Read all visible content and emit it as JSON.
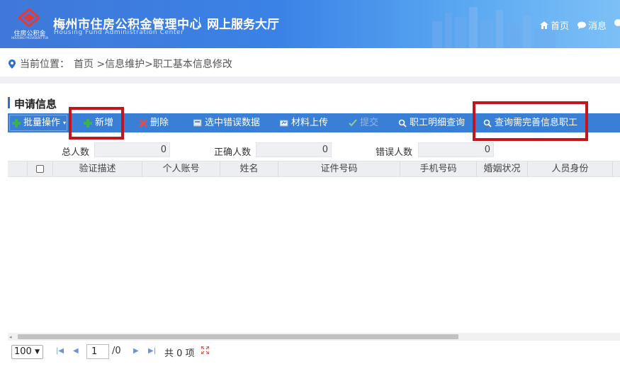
{
  "header": {
    "logo_text": "住房公积金",
    "logo_sub": "HOUSING PROVIDENT FUND",
    "title": "梅州市住房公积金管理中心",
    "hall": "网上服务大厅",
    "subtitle_en": "Housing Fund Administration Center",
    "nav_home": "首页",
    "nav_messages": "消息"
  },
  "breadcrumb": {
    "label": "当前位置：",
    "path": "首页 >信息维护>职工基本信息修改"
  },
  "section": {
    "title": "申请信息"
  },
  "toolbar": {
    "batch": "批量操作",
    "add": "新增",
    "delete": "删除",
    "select_errors": "选中错误数据",
    "upload": "材料上传",
    "submit": "提交",
    "detail_query": "职工明细查询",
    "query_incomplete": "查询需完善信息职工"
  },
  "stats": {
    "total_label": "总人数",
    "total_value": "0",
    "correct_label": "正确人数",
    "correct_value": "0",
    "error_label": "错误人数",
    "error_value": "0"
  },
  "table": {
    "columns": [
      "验证描述",
      "个人账号",
      "姓名",
      "证件号码",
      "手机号码",
      "婚姻状况",
      "人员身份"
    ],
    "rows": []
  },
  "pager": {
    "page_size": "100",
    "current_page": "1",
    "total_pages": "/0",
    "total_items": "共 0 项"
  },
  "colors": {
    "header_blue": "#3b82e6",
    "toolbar_blue": "#3a7fd6",
    "highlight_red": "#c0161c"
  }
}
